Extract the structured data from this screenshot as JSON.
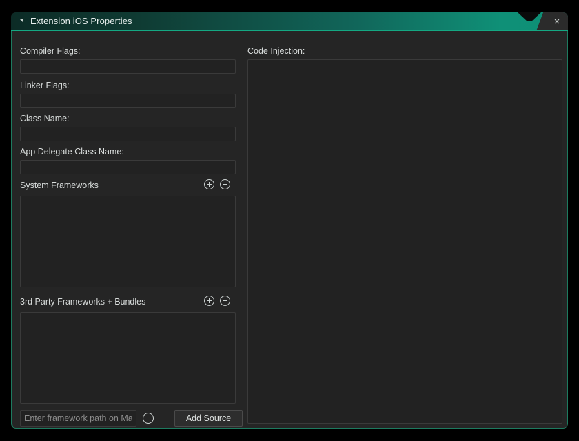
{
  "window": {
    "title": "Extension iOS Properties",
    "collapse_icon": "triangle-collapse-icon",
    "close_label": "×"
  },
  "left_pane": {
    "fields": [
      {
        "label": "Compiler Flags:",
        "value": "",
        "name": "compiler-flags"
      },
      {
        "label": "Linker Flags:",
        "value": "",
        "name": "linker-flags"
      },
      {
        "label": "Class Name:",
        "value": "",
        "name": "class-name"
      },
      {
        "label": "App Delegate Class Name:",
        "value": "",
        "name": "app-delegate-class-name"
      }
    ],
    "system_frameworks": {
      "title": "System Frameworks",
      "add_label": "+",
      "remove_label": "−",
      "items": []
    },
    "third_party_frameworks": {
      "title": "3rd Party Frameworks + Bundles",
      "add_label": "+",
      "remove_label": "−",
      "items": []
    },
    "bottom_row": {
      "path_placeholder": "Enter framework path on Mac",
      "path_value": "",
      "add_path_label": "+",
      "add_source_label": "Add Source"
    }
  },
  "right_pane": {
    "code_injection_label": "Code Injection:",
    "code_injection_value": ""
  },
  "colors": {
    "accent_teal": "#14a883",
    "border_green": "#1d7a5f",
    "panel_bg": "#252525",
    "input_bg": "#222222",
    "text": "#d8dcdb"
  }
}
